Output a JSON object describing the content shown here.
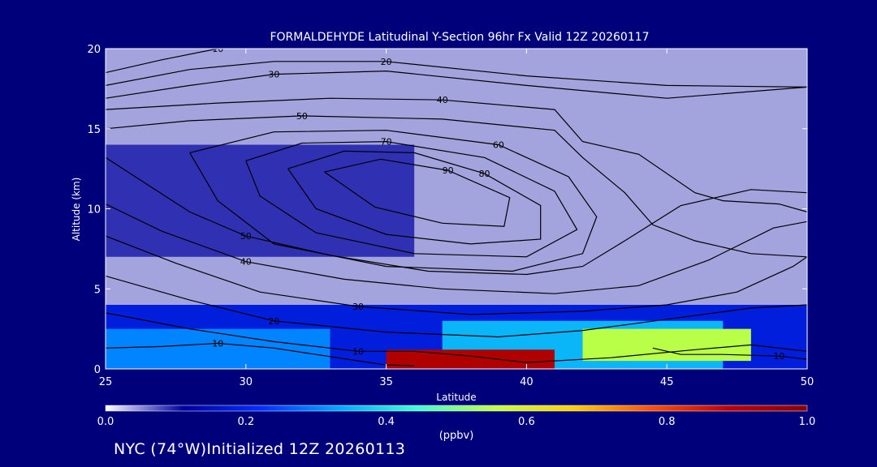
{
  "chart_data": {
    "type": "heatmap",
    "title": "FORMALDEHYDE Latitudinal Y-Section 96hr  Fx Valid 12Z 20260117",
    "xlabel": "Latitude",
    "ylabel": "Altitude (km)",
    "xlim": [
      25,
      50
    ],
    "ylim": [
      0,
      20
    ],
    "x_ticks": [
      "25",
      "30",
      "35",
      "40",
      "45",
      "50"
    ],
    "y_ticks": [
      "0",
      "5",
      "10",
      "15",
      "20"
    ],
    "colorbar": {
      "label": "(ppbv)",
      "range": [
        0.0,
        1.0
      ],
      "ticks": [
        "0.0",
        "0.2",
        "0.4",
        "0.6",
        "0.8",
        "1.0"
      ],
      "colors": [
        "#ffffff",
        "#0000a0",
        "#0030ff",
        "#00a8ff",
        "#40ffd0",
        "#c0ff40",
        "#ffd000",
        "#ff5000",
        "#c00000",
        "#8b0000"
      ]
    },
    "field_regions": [
      {
        "lat": [
          25,
          50
        ],
        "alt": [
          0,
          20
        ],
        "value": 0.04
      },
      {
        "lat": [
          25,
          36
        ],
        "alt": [
          7,
          14
        ],
        "value": 0.09
      },
      {
        "lat": [
          25,
          50
        ],
        "alt": [
          0,
          4
        ],
        "value": 0.18
      },
      {
        "lat": [
          25,
          33
        ],
        "alt": [
          0,
          2.5
        ],
        "value": 0.3
      },
      {
        "lat": [
          37,
          47
        ],
        "alt": [
          0,
          3
        ],
        "value": 0.35
      },
      {
        "lat": [
          42,
          48
        ],
        "alt": [
          0.5,
          2.5
        ],
        "value": 0.55
      },
      {
        "lat": [
          35,
          41
        ],
        "alt": [
          0,
          1.2
        ],
        "value": 0.92
      }
    ],
    "contour_labels": [
      "10",
      "20",
      "30",
      "40",
      "50",
      "60",
      "10",
      "20",
      "30",
      "40",
      "50",
      "60",
      "30",
      "20",
      "10",
      "10",
      "10",
      "10"
    ],
    "contours": [
      {
        "label": "10",
        "points": [
          [
            25,
            18.5
          ],
          [
            27,
            19.3
          ],
          [
            29,
            20
          ]
        ]
      },
      {
        "label": "20",
        "points": [
          [
            25,
            17.7
          ],
          [
            28,
            18.7
          ],
          [
            31,
            19.2
          ],
          [
            35,
            19.2
          ],
          [
            40,
            18.3
          ],
          [
            45,
            17.7
          ],
          [
            50,
            17.6
          ]
        ]
      },
      {
        "label": "30",
        "points": [
          [
            25,
            16.9
          ],
          [
            28,
            17.7
          ],
          [
            31,
            18.4
          ],
          [
            35,
            18.6
          ],
          [
            40,
            17.7
          ],
          [
            45,
            16.9
          ],
          [
            50,
            17.6
          ]
        ]
      },
      {
        "label": "40",
        "points": [
          [
            25,
            16.2
          ],
          [
            29,
            16.6
          ],
          [
            33,
            16.9
          ],
          [
            37,
            16.8
          ],
          [
            41,
            16.2
          ],
          [
            42,
            14.2
          ],
          [
            44,
            13.4
          ],
          [
            46,
            11
          ],
          [
            47,
            10.5
          ],
          [
            49,
            10.3
          ],
          [
            50,
            9.8
          ]
        ]
      },
      {
        "label": "50",
        "points": [
          [
            25,
            15
          ],
          [
            28,
            15.5
          ],
          [
            32,
            15.8
          ],
          [
            37,
            15.6
          ],
          [
            41,
            14.9
          ],
          [
            42,
            13.2
          ],
          [
            43.5,
            11
          ],
          [
            44.5,
            9
          ],
          [
            46,
            8
          ],
          [
            48,
            7.2
          ],
          [
            50,
            7
          ]
        ]
      },
      {
        "label": "60",
        "points": [
          [
            28,
            13.5
          ],
          [
            31,
            14.8
          ],
          [
            35,
            14.9
          ],
          [
            39,
            14
          ],
          [
            41.5,
            12
          ],
          [
            42.5,
            9.5
          ],
          [
            42,
            7.2
          ],
          [
            39.5,
            6.1
          ],
          [
            35,
            6.4
          ],
          [
            31,
            7.8
          ],
          [
            29,
            10.5
          ],
          [
            28,
            13.5
          ]
        ]
      },
      {
        "label": "70",
        "points": [
          [
            30,
            13
          ],
          [
            32,
            14.1
          ],
          [
            35,
            14.2
          ],
          [
            38.5,
            13.2
          ],
          [
            41,
            11.1
          ],
          [
            41.8,
            8.7
          ],
          [
            40,
            7
          ],
          [
            36,
            7.2
          ],
          [
            32.5,
            8.5
          ],
          [
            30.5,
            10.8
          ],
          [
            30,
            13
          ]
        ]
      },
      {
        "label": "80",
        "points": [
          [
            31.5,
            12.5
          ],
          [
            33.5,
            13.6
          ],
          [
            36,
            13.5
          ],
          [
            38.5,
            12.2
          ],
          [
            40.5,
            10.2
          ],
          [
            40.5,
            8.1
          ],
          [
            38,
            7.8
          ],
          [
            35,
            8.4
          ],
          [
            32.5,
            10
          ],
          [
            31.5,
            12.5
          ]
        ]
      },
      {
        "label": "90",
        "points": [
          [
            32.8,
            12.3
          ],
          [
            34.8,
            13.1
          ],
          [
            37.2,
            12.4
          ],
          [
            39.4,
            10.7
          ],
          [
            39.2,
            8.9
          ],
          [
            37,
            9.1
          ],
          [
            34.6,
            10.1
          ],
          [
            32.8,
            12.3
          ]
        ]
      },
      {
        "label": "50",
        "points": [
          [
            25,
            13.2
          ],
          [
            26.5,
            11.5
          ],
          [
            28,
            9.8
          ],
          [
            30,
            8.3
          ],
          [
            33,
            7.1
          ],
          [
            36.5,
            6.1
          ],
          [
            40,
            5.9
          ],
          [
            42,
            6.4
          ],
          [
            43.5,
            8
          ],
          [
            45.5,
            10.2
          ],
          [
            48,
            11.2
          ],
          [
            50,
            11
          ]
        ]
      },
      {
        "label": "40",
        "points": [
          [
            25,
            10.3
          ],
          [
            27,
            8.6
          ],
          [
            30,
            6.7
          ],
          [
            33.5,
            5.6
          ],
          [
            37,
            5
          ],
          [
            41,
            4.7
          ],
          [
            44,
            5.2
          ],
          [
            46.5,
            6.8
          ],
          [
            48.8,
            8.8
          ],
          [
            50,
            9.2
          ]
        ]
      },
      {
        "label": "30",
        "points": [
          [
            25,
            8.3
          ],
          [
            27.5,
            6.6
          ],
          [
            30.5,
            4.8
          ],
          [
            34,
            3.9
          ],
          [
            38,
            3.4
          ],
          [
            42,
            3.6
          ],
          [
            45,
            4
          ],
          [
            47.5,
            4.8
          ],
          [
            49.5,
            6.4
          ],
          [
            50,
            7
          ]
        ]
      },
      {
        "label": "20",
        "points": [
          [
            25,
            5.8
          ],
          [
            28,
            4.3
          ],
          [
            31,
            3
          ],
          [
            35,
            2.3
          ],
          [
            39,
            2
          ],
          [
            42,
            2.4
          ],
          [
            45,
            3.1
          ],
          [
            48,
            3.8
          ],
          [
            50,
            4
          ]
        ]
      },
      {
        "label": "10",
        "points": [
          [
            25,
            3.5
          ],
          [
            28,
            2.5
          ],
          [
            31,
            1.7
          ],
          [
            34,
            1.1
          ],
          [
            36,
            1.1
          ],
          [
            38,
            0.8
          ],
          [
            40,
            0.4
          ],
          [
            43,
            0.7
          ],
          [
            46,
            1.2
          ],
          [
            48,
            1.5
          ],
          [
            50,
            1.1
          ]
        ]
      },
      {
        "label": "10",
        "points": [
          [
            25,
            1.3
          ],
          [
            27,
            1.4
          ],
          [
            29,
            1.6
          ],
          [
            31,
            1.3
          ],
          [
            32.5,
            0.9
          ],
          [
            34,
            0.5
          ],
          [
            35,
            0.25
          ],
          [
            36,
            0.2
          ]
        ]
      },
      {
        "label": "10",
        "points": [
          [
            44.5,
            1.3
          ],
          [
            45.5,
            0.9
          ],
          [
            47,
            0.9
          ],
          [
            49,
            0.8
          ],
          [
            50,
            0.6
          ]
        ]
      }
    ]
  },
  "footer": {
    "text": "NYC (74°W)Initialized 12Z 20260113"
  }
}
